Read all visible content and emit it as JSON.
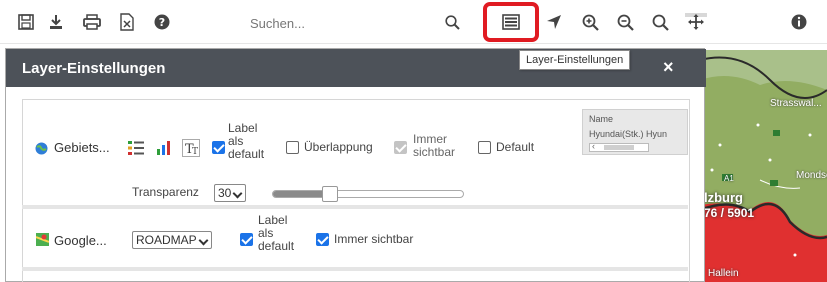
{
  "toolbar": {
    "search_placeholder": "Suchen...",
    "tooltip": "Layer-Einstellungen",
    "highlight_color": "#e01b22",
    "icons": [
      "save-icon",
      "download-icon",
      "print-icon",
      "excel-icon",
      "help-icon",
      "search-icon",
      "layer-settings-icon",
      "locate-icon",
      "zoom-in-icon",
      "zoom-out-icon",
      "zoom-search-icon",
      "pan-icon",
      "info-icon"
    ]
  },
  "dialog": {
    "title": "Layer-Einstellungen",
    "close_label": "×",
    "header_color": "#4d5259"
  },
  "layers": [
    {
      "name": "Gebiets...",
      "icon": "globe-icon",
      "tools": [
        "legend-icon",
        "bar-chart-icon",
        "text-style-icon"
      ],
      "label_default": {
        "label": "Label als default",
        "line1": "Label",
        "line2": "als",
        "line3": "default",
        "checked": true
      },
      "overlap": {
        "label": "Überlappung",
        "checked": false
      },
      "always_visible": {
        "line1": "Immer",
        "line2": "sichtbar",
        "checked": true,
        "disabled": true
      },
      "default": {
        "label": "Default",
        "checked": false
      },
      "table": {
        "header": "Name",
        "cell": "Hyundai(Stk.) Hyun"
      },
      "transparency_label": "Transparenz",
      "transparency_value": "30",
      "transparency_slider": 0.3
    },
    {
      "name": "Google...",
      "icon": "google-maps-icon",
      "map_type": "ROADMAP",
      "label_default": {
        "line1": "Label",
        "line2": "als",
        "line3": "default",
        "checked": true
      },
      "always_visible": {
        "label": "Immer sichtbar",
        "checked": true
      }
    }
  ],
  "map": {
    "labels": [
      "Strasswal...",
      "Mondse",
      "Hallein"
    ],
    "city_label": "lzburg",
    "coord": "76 / 5901",
    "road_marker": "A1",
    "red_color": "#e03030"
  }
}
